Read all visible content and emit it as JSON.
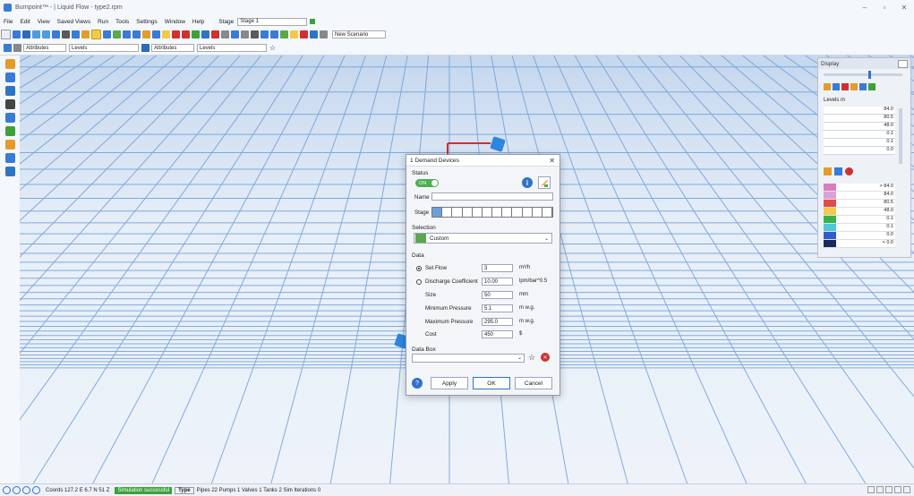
{
  "window": {
    "title": "Burnpoint™ - | Liquid Flow - type2.rpm"
  },
  "menu": [
    "File",
    "Edit",
    "View",
    "Saved Views",
    "Run",
    "Tools",
    "Settings",
    "Window",
    "Help"
  ],
  "stage": {
    "label": "Stage",
    "value": "Stage 1"
  },
  "toolbar": {
    "scenario": "New Scenario"
  },
  "toolbar2": {
    "attributes1": "Attributes",
    "levels1": "Levels",
    "attributes2": "Attributes",
    "levels2": "Levels"
  },
  "dialog": {
    "title": "1 Demand Devices",
    "status_section": "Status",
    "status_toggle": "ON",
    "name_label": "Name",
    "name_value": "",
    "stage_label": "Stage",
    "selection_section": "Selection",
    "selection_value": "Custom",
    "data_section": "Data",
    "rows": [
      {
        "label": "Set Flow",
        "value": "3",
        "unit": "m³/h"
      },
      {
        "label": "Discharge Coefficient",
        "value": "10.00",
        "unit": "lpm/bar^0.5"
      },
      {
        "label": "Size",
        "value": "50",
        "unit": "mm"
      },
      {
        "label": "Minimum Pressure",
        "value": "5.1",
        "unit": "m w.g."
      },
      {
        "label": "Maximum Pressure",
        "value": "295.0",
        "unit": "m w.g."
      },
      {
        "label": "Cost",
        "value": "450",
        "unit": "$"
      }
    ],
    "databox_section": "Data Box",
    "apply": "Apply",
    "ok": "OK",
    "cancel": "Cancel"
  },
  "panel": {
    "title": "Display",
    "levels_title": "Levels m",
    "levels": [
      "84.0",
      "80.5",
      "48.0",
      "0.1",
      "0.1",
      "0.0"
    ],
    "legend": [
      {
        "color": "#d67fbf",
        "value": "> 84.0"
      },
      {
        "color": "#d9a3d6",
        "value": "84.0"
      },
      {
        "color": "#e34b4b",
        "value": "80.5"
      },
      {
        "color": "#f2c94c",
        "value": "48.0"
      },
      {
        "color": "#35b34a",
        "value": "0.1"
      },
      {
        "color": "#4dc8d6",
        "value": "0.1"
      },
      {
        "color": "#2f5bd1",
        "value": "0.0"
      },
      {
        "color": "#1a2a5a",
        "value": "< 0.0"
      }
    ]
  },
  "status": {
    "coords": "Coords 127.2 E   6.7 N   51 Z",
    "simulation": "Simulation successful",
    "type_label": "Type",
    "summary": "Pipes 22  Pumps 1  Valves 1  Tanks 2  Sim Iterations 0"
  },
  "colors": {
    "accent": "#2f74c6",
    "success": "#3ba13b",
    "pipe": "#d03030"
  }
}
